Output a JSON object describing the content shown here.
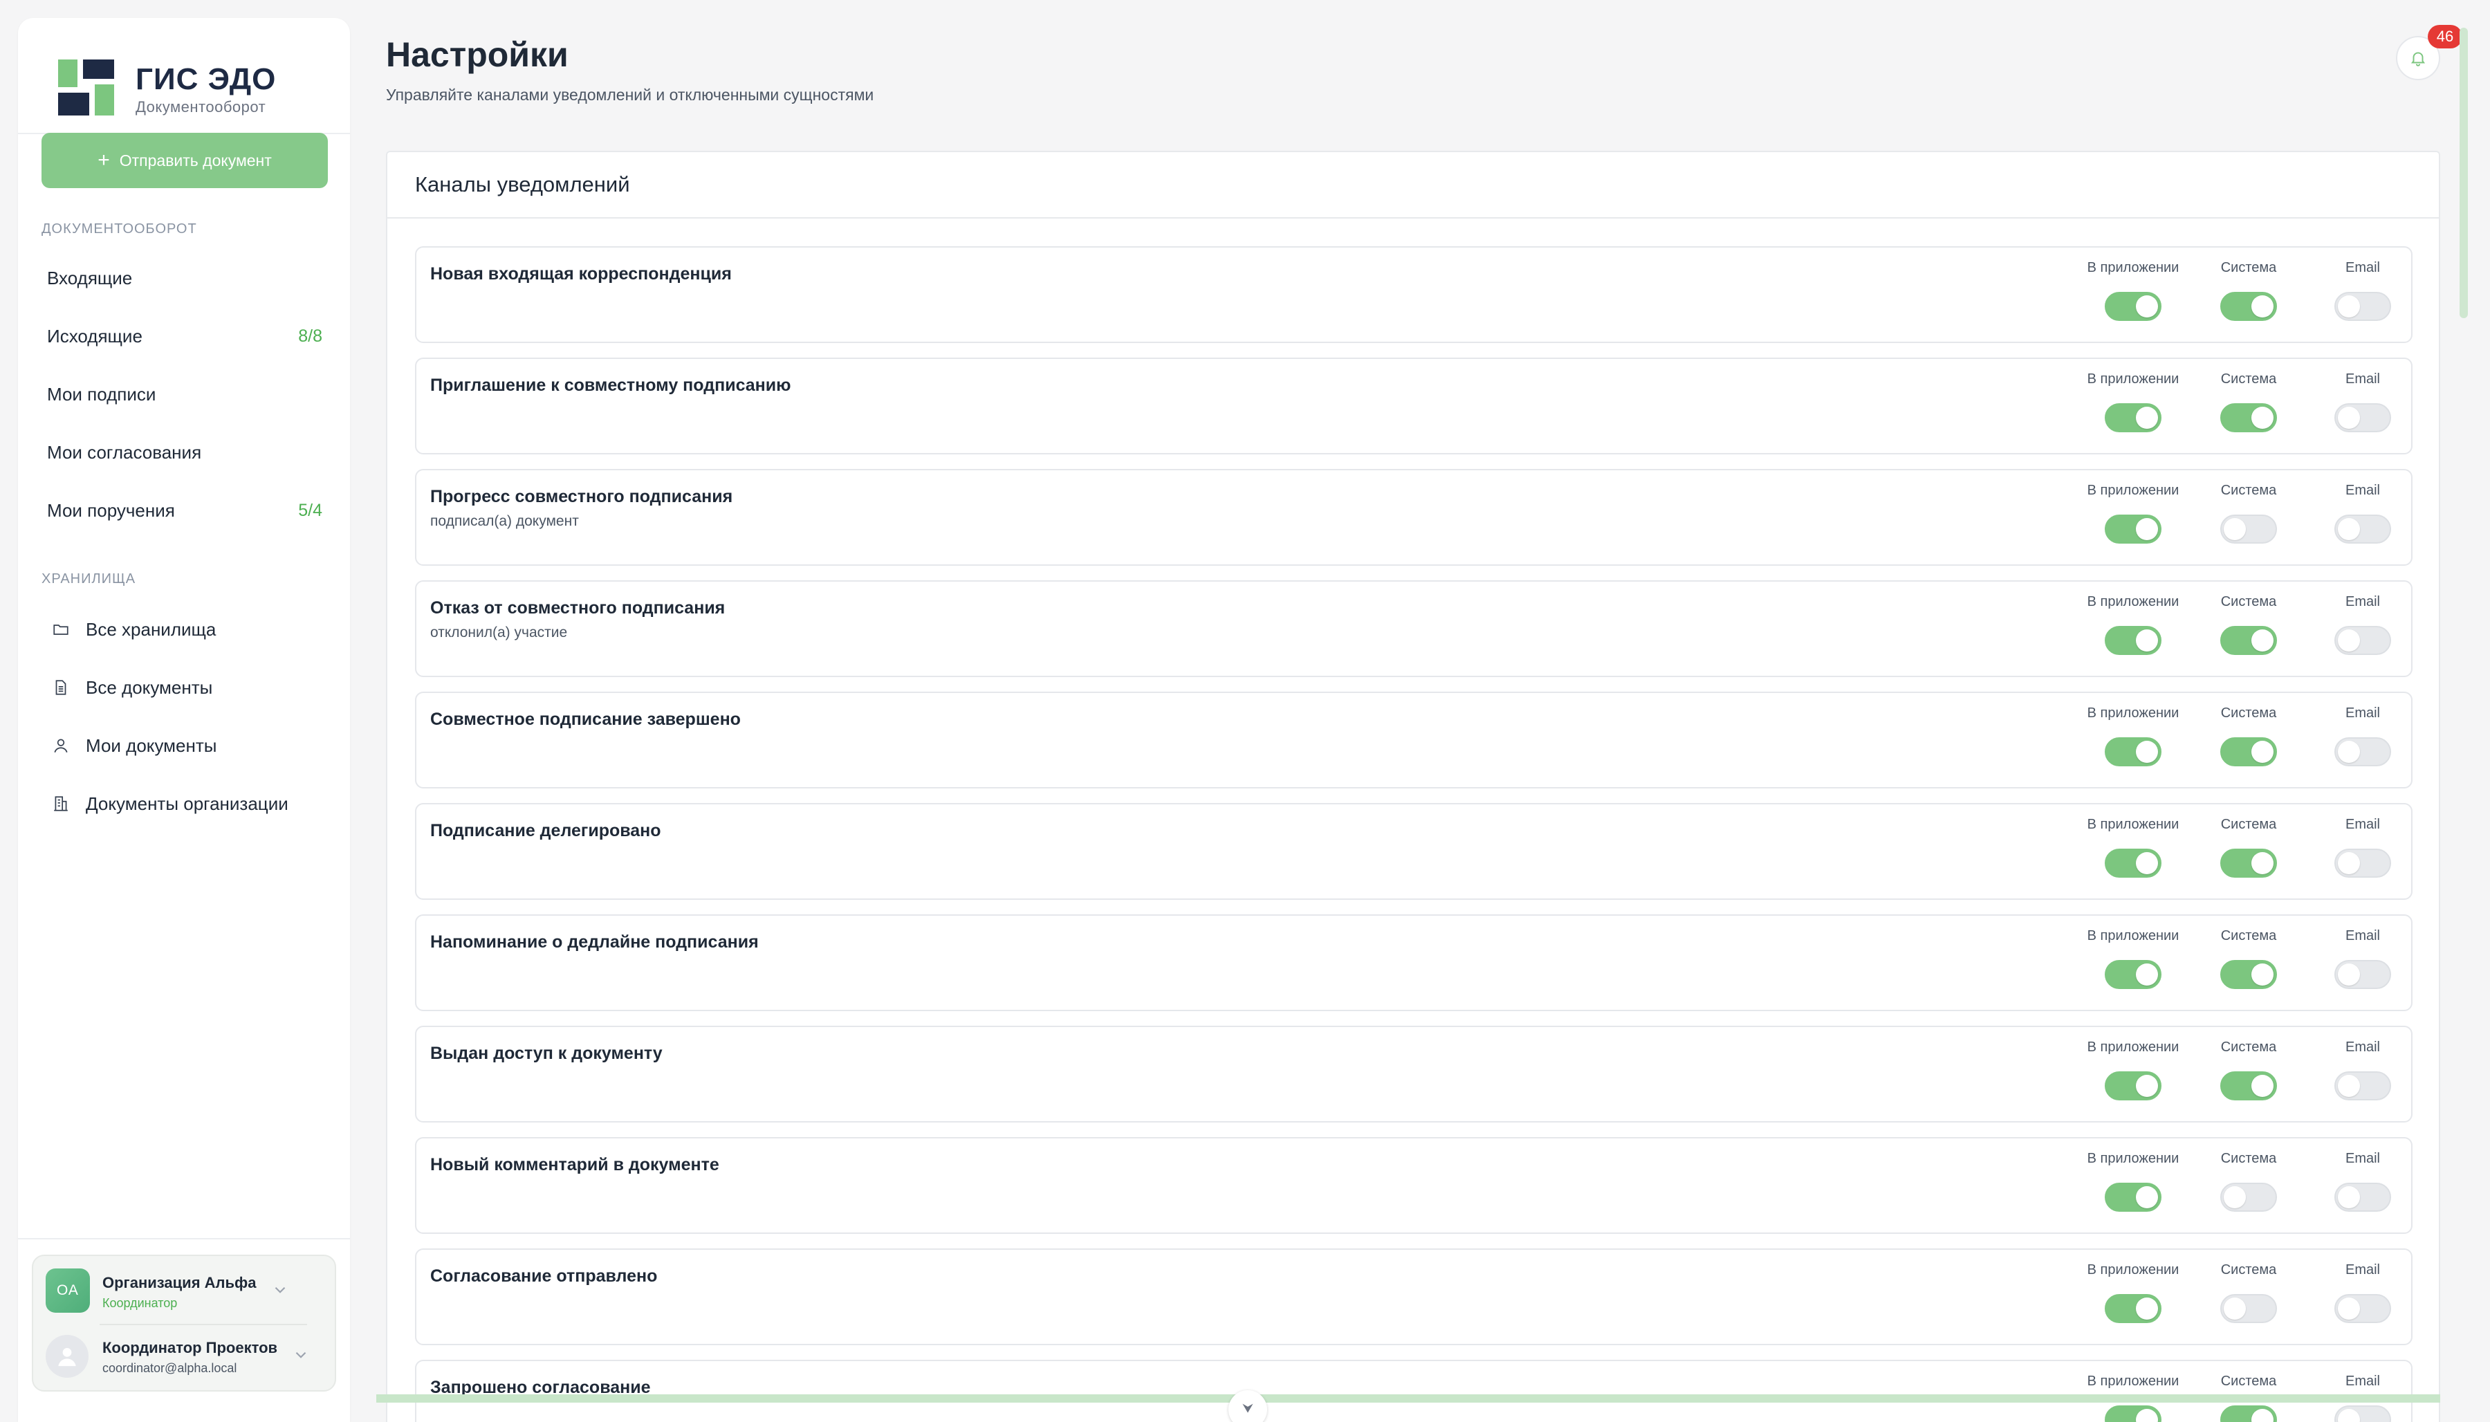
{
  "brand": {
    "title": "ГИС ЭДО",
    "subtitle": "Документооборот",
    "logo_colors": [
      "#1e2a44",
      "#7cc67f"
    ]
  },
  "sidebar": {
    "send_button_label": "Отправить документ",
    "sections": {
      "docflow_label": "ДОКУМЕНТООБОРОТ",
      "storage_label": "ХРАНИЛИЩА"
    },
    "docflow_items": [
      {
        "label": "Входящие",
        "count": ""
      },
      {
        "label": "Исходящие",
        "count": "8/8"
      },
      {
        "label": "Мои подписи",
        "count": ""
      },
      {
        "label": "Мои согласования",
        "count": ""
      },
      {
        "label": "Мои поручения",
        "count": "5/4"
      }
    ],
    "storage_items": [
      {
        "label": "Все хранилища",
        "icon": "folder-icon"
      },
      {
        "label": "Все документы",
        "icon": "document-icon"
      },
      {
        "label": "Мои документы",
        "icon": "user-icon"
      },
      {
        "label": "Документы организации",
        "icon": "building-icon"
      }
    ],
    "account": {
      "org_initials": "ОА",
      "org_name": "Организация Альфа",
      "org_role": "Координатор",
      "user_name": "Координатор Проектов",
      "user_email": "coordinator@alpha.local"
    }
  },
  "header": {
    "title": "Настройки",
    "subtitle": "Управляйте каналами уведомлений и отключенными сущностями",
    "notification_count": "46"
  },
  "panel": {
    "title": "Каналы уведомлений",
    "channel_labels": [
      "В приложении",
      "Система",
      "Email"
    ],
    "accent_color": "#7cc67f",
    "items": [
      {
        "title": "Новая входящая корреспонденция",
        "desc": "",
        "app": true,
        "system": true,
        "email": false
      },
      {
        "title": "Приглашение к совместному подписанию",
        "desc": "",
        "app": true,
        "system": true,
        "email": false
      },
      {
        "title": "Прогресс совместного подписания",
        "desc": "подписал(а) документ",
        "app": true,
        "system": false,
        "email": false
      },
      {
        "title": "Отказ от совместного подписания",
        "desc": "отклонил(а) участие",
        "app": true,
        "system": true,
        "email": false
      },
      {
        "title": "Совместное подписание завершено",
        "desc": "",
        "app": true,
        "system": true,
        "email": false
      },
      {
        "title": "Подписание делегировано",
        "desc": "",
        "app": true,
        "system": true,
        "email": false
      },
      {
        "title": "Напоминание о дедлайне подписания",
        "desc": "",
        "app": true,
        "system": true,
        "email": false
      },
      {
        "title": "Выдан доступ к документу",
        "desc": "",
        "app": true,
        "system": true,
        "email": false
      },
      {
        "title": "Новый комментарий в документе",
        "desc": "",
        "app": true,
        "system": false,
        "email": false
      },
      {
        "title": "Согласование отправлено",
        "desc": "",
        "app": true,
        "system": false,
        "email": false
      },
      {
        "title": "Запрошено согласование",
        "desc": "",
        "app": true,
        "system": true,
        "email": false
      }
    ]
  }
}
